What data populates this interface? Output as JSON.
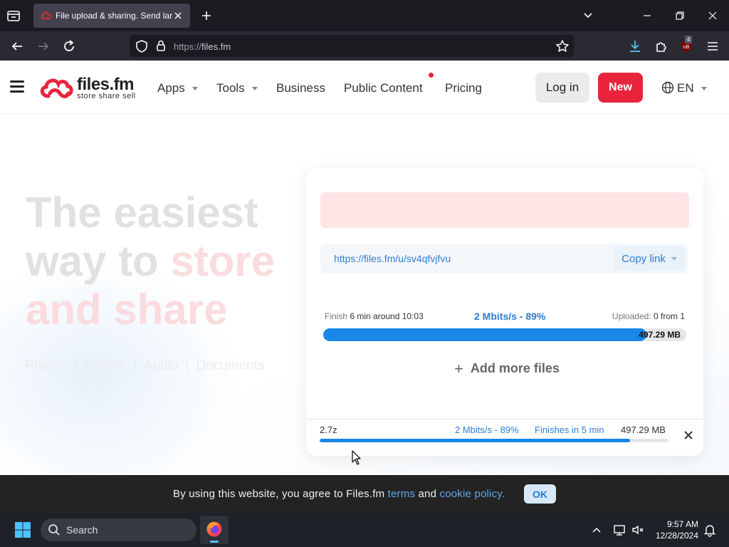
{
  "browser": {
    "tab_title": "File upload & sharing. Send large files",
    "url_scheme": "https://",
    "url_host": "files.fm",
    "extension_badge": "4"
  },
  "site": {
    "logo_name": "files.fm",
    "logo_tagline": "store share sell",
    "nav": {
      "apps": "Apps",
      "tools": "Tools",
      "business": "Business",
      "public_content": "Public Content",
      "pricing": "Pricing"
    },
    "login": "Log in",
    "new": "New",
    "language": "EN"
  },
  "hero": {
    "headline_line1": "The easiest",
    "headline_line2_a": "way to ",
    "headline_line2_b": "store",
    "headline_line3": "and share",
    "media_types": [
      "Photos",
      "Videos",
      "Audio",
      "Documents"
    ],
    "separator": "|"
  },
  "upload": {
    "share_link": "https://files.fm/u/sv4qfvjfvu",
    "copy_link": "Copy link",
    "finish_label": "Finish",
    "finish_value": "6 min around 10:03",
    "speed_summary": "2 Mbits/s - 89%",
    "uploaded_label": "Uploaded:",
    "uploaded_value": "0 from 1",
    "total_size": "497.29 MB",
    "progress_fraction": 0.89,
    "add_more": "Add more files",
    "file": {
      "name": "2.7z",
      "speed": "2 Mbits/s - 89%",
      "eta": "Finishes in 5 min",
      "size": "497.29 MB",
      "progress_fraction": 0.89
    }
  },
  "cookie": {
    "text_before": "By using this website, you agree to Files.fm ",
    "terms": "terms",
    "and": " and ",
    "policy": "cookie policy.",
    "ok": "OK"
  },
  "taskbar": {
    "search": "Search",
    "time": "9:57 AM",
    "date": "12/28/2024"
  },
  "colors": {
    "brand_red": "#e8243c",
    "accent_blue": "#1887e8",
    "link_blue": "#2e7dd1"
  }
}
